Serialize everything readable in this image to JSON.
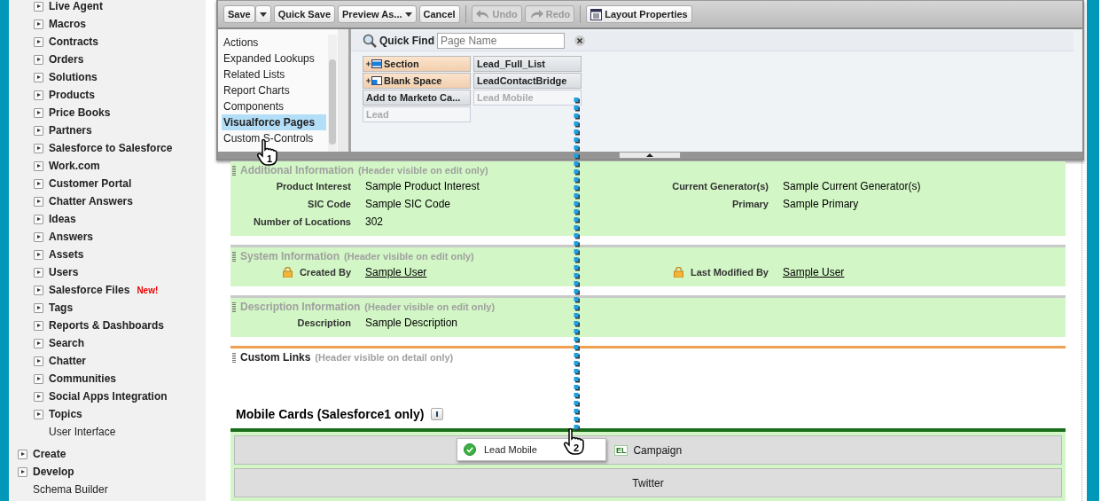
{
  "sidebar": {
    "sub_items": [
      {
        "label": "Live Agent",
        "expandable": true
      },
      {
        "label": "Macros",
        "expandable": true
      },
      {
        "label": "Contracts",
        "expandable": true
      },
      {
        "label": "Orders",
        "expandable": true
      },
      {
        "label": "Solutions",
        "expandable": true
      },
      {
        "label": "Products",
        "expandable": true
      },
      {
        "label": "Price Books",
        "expandable": true
      },
      {
        "label": "Partners",
        "expandable": true
      },
      {
        "label": "Salesforce to Salesforce",
        "expandable": true
      },
      {
        "label": "Work.com",
        "expandable": true
      },
      {
        "label": "Customer Portal",
        "expandable": true
      },
      {
        "label": "Chatter Answers",
        "expandable": true
      },
      {
        "label": "Ideas",
        "expandable": true
      },
      {
        "label": "Answers",
        "expandable": true
      },
      {
        "label": "Assets",
        "expandable": true
      },
      {
        "label": "Users",
        "expandable": true
      },
      {
        "label": "Salesforce Files",
        "expandable": true,
        "badge": "New!"
      },
      {
        "label": "Tags",
        "expandable": true
      },
      {
        "label": "Reports & Dashboards",
        "expandable": true
      },
      {
        "label": "Search",
        "expandable": true
      },
      {
        "label": "Chatter",
        "expandable": true
      },
      {
        "label": "Communities",
        "expandable": true
      },
      {
        "label": "Social Apps Integration",
        "expandable": true
      },
      {
        "label": "Topics",
        "expandable": true
      },
      {
        "label": "User Interface",
        "expandable": false
      }
    ],
    "items": [
      {
        "label": "Create",
        "expandable": true
      },
      {
        "label": "Develop",
        "expandable": true
      },
      {
        "label": "Schema Builder",
        "expandable": false
      }
    ]
  },
  "toolbar": {
    "groups": [
      {
        "buttons": [
          {
            "label": "Save",
            "kind": "split",
            "disabled": false
          },
          {
            "label": "Quick Save",
            "kind": "plain",
            "disabled": false
          },
          {
            "label": "Preview As...",
            "kind": "dropdown",
            "disabled": false
          },
          {
            "label": "Cancel",
            "kind": "plain",
            "disabled": false
          }
        ]
      },
      {
        "buttons": [
          {
            "label": "Undo",
            "kind": "undo",
            "disabled": true
          },
          {
            "label": "Redo",
            "kind": "redo",
            "disabled": true
          }
        ]
      },
      {
        "buttons": [
          {
            "label": "Layout Properties",
            "kind": "properties",
            "disabled": false
          }
        ]
      }
    ]
  },
  "palette": {
    "categories": [
      {
        "label": "Actions",
        "selected": false
      },
      {
        "label": "Expanded Lookups",
        "selected": false
      },
      {
        "label": "Related Lists",
        "selected": false
      },
      {
        "label": "Report Charts",
        "selected": false
      },
      {
        "label": "Components",
        "selected": false
      },
      {
        "label": "Visualforce Pages",
        "selected": true
      },
      {
        "label": "Custom S-Controls",
        "selected": false
      }
    ],
    "quick_find": {
      "label": "Quick Find",
      "placeholder": "Page Name"
    },
    "elements": [
      {
        "label": "Section",
        "kind": "section",
        "used": false
      },
      {
        "label": "Lead_Full_List",
        "kind": "page",
        "used": false
      },
      {
        "label": "Blank Space",
        "kind": "blank",
        "used": false
      },
      {
        "label": "LeadContactBridge",
        "kind": "page",
        "used": false
      },
      {
        "label": "Add to Marketo Ca...",
        "kind": "page",
        "used": false
      },
      {
        "label": "Lead Mobile",
        "kind": "page",
        "used": true
      },
      {
        "label": "Lead",
        "kind": "page",
        "used": true
      }
    ]
  },
  "sections": [
    {
      "kind": "fields",
      "title": "Additional Information",
      "note": "(Header visible on edit only)",
      "columns": [
        [
          {
            "label": "Product Interest",
            "value": "Sample Product Interest",
            "locked": false,
            "link": false
          },
          {
            "label": "SIC Code",
            "value": "Sample SIC Code",
            "locked": false,
            "link": false
          },
          {
            "label": "Number of Locations",
            "value": "302",
            "locked": false,
            "link": false
          }
        ],
        [
          {
            "label": "Current Generator(s)",
            "value": "Sample Current Generator(s)",
            "locked": false,
            "link": false
          },
          {
            "label": "Primary",
            "value": "Sample Primary",
            "locked": false,
            "link": false
          }
        ]
      ]
    },
    {
      "kind": "fields",
      "title": "System Information",
      "note": "(Header visible on edit only)",
      "columns": [
        [
          {
            "label": "Created By",
            "value": "Sample User",
            "locked": true,
            "link": true
          }
        ],
        [
          {
            "label": "Last Modified By",
            "value": "Sample User",
            "locked": true,
            "link": true
          }
        ]
      ]
    },
    {
      "kind": "fields",
      "title": "Description Information",
      "note": "(Header visible on edit only)",
      "columns": [
        [
          {
            "label": "Description",
            "value": "Sample Description",
            "locked": false,
            "link": false
          }
        ]
      ]
    },
    {
      "kind": "links",
      "title": "Custom Links",
      "note": "(Header visible on detail only)"
    }
  ],
  "mobile_cards": {
    "title": "Mobile Cards (Salesforce1 only)",
    "cards": [
      {
        "label": "Campaign",
        "badge": "EL"
      },
      {
        "label": "Twitter"
      }
    ]
  },
  "drag": {
    "label": "Lead Mobile",
    "cursors": [
      {
        "number": "1"
      },
      {
        "number": "2"
      }
    ]
  }
}
